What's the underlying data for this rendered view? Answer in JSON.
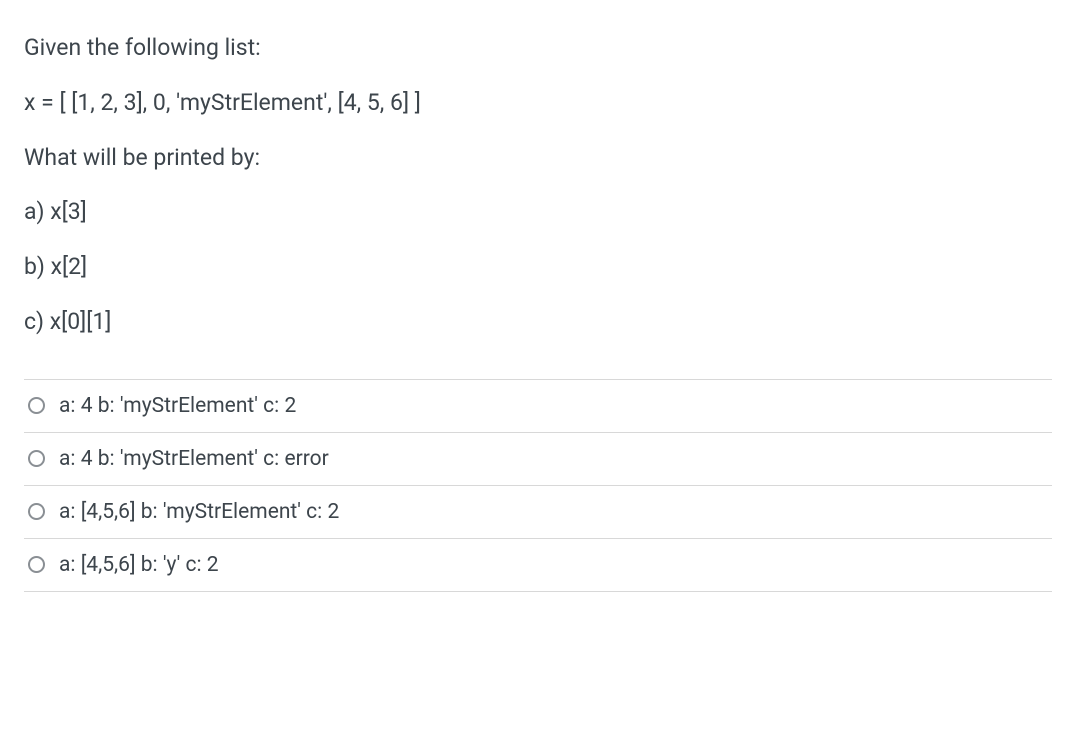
{
  "question": {
    "line1": "Given the following list:",
    "line2": "x = [ [1, 2, 3], 0, 'myStrElement', [4, 5, 6] ]",
    "line3": "What will be printed by:",
    "line4": "a) x[3]",
    "line5": "b) x[2]",
    "line6": "c) x[0][1]"
  },
  "options": [
    {
      "label": "a: 4 b: 'myStrElement' c: 2"
    },
    {
      "label": "a: 4 b: 'myStrElement' c: error"
    },
    {
      "label": "a: [4,5,6] b: 'myStrElement' c: 2"
    },
    {
      "label": "a: [4,5,6] b: 'y' c: 2"
    }
  ]
}
